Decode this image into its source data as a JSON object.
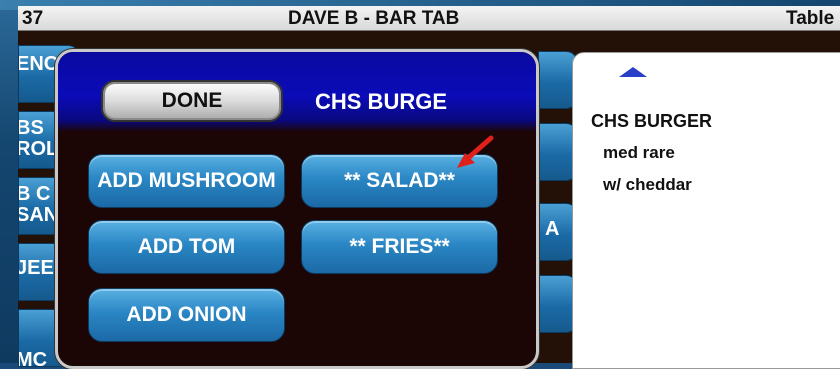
{
  "header": {
    "number": "37",
    "title": "DAVE B - BAR TAB",
    "table_label": "Table"
  },
  "background_menu": {
    "left_buttons": [
      {
        "lines": [
          "ENC"
        ]
      },
      {
        "lines": [
          "BS",
          "ROL"
        ]
      },
      {
        "lines": [
          "B C",
          "SAN"
        ]
      },
      {
        "lines": [
          "JEE"
        ]
      },
      {
        "lines": [
          "MC"
        ]
      }
    ],
    "right_buttons": [
      "",
      "",
      "A",
      ""
    ]
  },
  "popup": {
    "done_label": "DONE",
    "item_title": "CHS BURGE",
    "modifiers": [
      {
        "label": "ADD MUSHROOM"
      },
      {
        "label": "** SALAD**"
      },
      {
        "label": "ADD TOM"
      },
      {
        "label": "** FRIES**"
      },
      {
        "label": "ADD ONION"
      }
    ]
  },
  "order": {
    "item": "CHS BURGER",
    "modifiers": [
      "med rare",
      "w/ cheddar"
    ]
  },
  "colors": {
    "popup_header": "#0b0bb8",
    "button_blue": "#2a86c4",
    "arrow_red": "#e0201a"
  }
}
